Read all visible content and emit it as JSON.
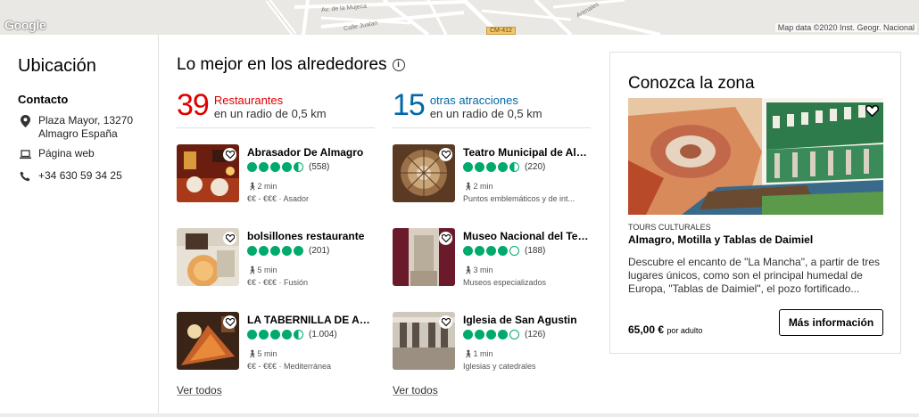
{
  "map": {
    "logo": "Google",
    "credit": "Map data ©2020 Inst. Geogr. Nacional",
    "streets": [
      "Av. de la Mujeca",
      "Calle Jualan",
      "Arenales"
    ],
    "road_badge": "CM-412"
  },
  "location": {
    "title": "Ubicación",
    "contact_heading": "Contacto",
    "address": "Plaza Mayor, 13270 Almagro España",
    "website": "Página web",
    "phone": "+34 630 59 34 25"
  },
  "nearby": {
    "title": "Lo mejor en los alrededores",
    "restaurants": {
      "count": "39",
      "label": "Restaurantes",
      "sub": "en un radio de 0,5 km",
      "color": "#e00000",
      "items": [
        {
          "name": "Abrasador De Almagro",
          "rating": 4.5,
          "reviews": "(558)",
          "walk": "2 min",
          "cat": "€€ - €€€  ·  Asador"
        },
        {
          "name": "bolsillones restaurante",
          "rating": 5,
          "reviews": "(201)",
          "walk": "5 min",
          "cat": "€€ - €€€  ·  Fusión"
        },
        {
          "name": "LA TABERNILLA DE ALMA...",
          "rating": 4.5,
          "reviews": "(1.004)",
          "walk": "5 min",
          "cat": "€€ - €€€  ·  Mediterránea"
        }
      ],
      "see_all": "Ver todos"
    },
    "attractions": {
      "count": "15",
      "label": "otras atracciones",
      "sub": "en un radio de 0,5 km",
      "color": "#0068a8",
      "items": [
        {
          "name": "Teatro Municipal de Alm...",
          "rating": 4.5,
          "reviews": "(220)",
          "walk": "2 min",
          "cat": "Puntos emblemáticos y de int..."
        },
        {
          "name": "Museo Nacional del Teatro",
          "rating": 4,
          "reviews": "(188)",
          "walk": "3 min",
          "cat": "Museos especializados"
        },
        {
          "name": "Iglesia de San Agustin",
          "rating": 4,
          "reviews": "(126)",
          "walk": "1 min",
          "cat": "Iglesias y catedrales"
        }
      ],
      "see_all": "Ver todos"
    }
  },
  "area": {
    "title": "Conozca la zona",
    "tour_category": "TOURS CULTURALES",
    "tour_name": "Almagro, Motilla y Tablas de Daimiel",
    "description": "Descubre el encanto de \"La Mancha\", a partir de tres lugares únicos, como son el principal humedal de Europa, \"Tablas de Daimiel\", el pozo fortificado...",
    "price": "65,00 €",
    "price_unit": "por adulto",
    "more_button": "Más información"
  }
}
